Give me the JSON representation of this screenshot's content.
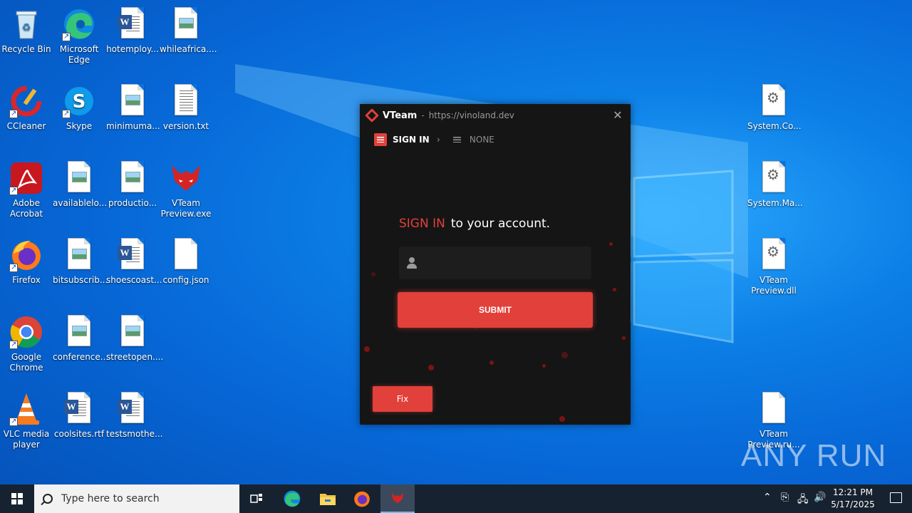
{
  "desktop": {
    "icons": [
      {
        "label": "Recycle Bin"
      },
      {
        "label": "Microsoft Edge"
      },
      {
        "label": "hotemploy..."
      },
      {
        "label": "whileafrica...."
      },
      {
        "label": "CCleaner"
      },
      {
        "label": "Skype"
      },
      {
        "label": "minimuma..."
      },
      {
        "label": "version.txt"
      },
      {
        "label": "Adobe Acrobat"
      },
      {
        "label": "availablelo..."
      },
      {
        "label": "productio..."
      },
      {
        "label": "VTeam Preview.exe"
      },
      {
        "label": "Firefox"
      },
      {
        "label": "bitsubscrib..."
      },
      {
        "label": "shoescoast..."
      },
      {
        "label": "config.json"
      },
      {
        "label": "Google Chrome"
      },
      {
        "label": "conference..."
      },
      {
        "label": "streetopen...."
      },
      {
        "label": "VLC media player"
      },
      {
        "label": "coolsites.rtf"
      },
      {
        "label": "testsmothe..."
      },
      {
        "label": "System.Co..."
      },
      {
        "label": "System.Ma..."
      },
      {
        "label": "VTeam Preview.dll"
      },
      {
        "label": "VTeam Preview.ru..."
      }
    ]
  },
  "app": {
    "name": "VTeam",
    "separator": "-",
    "url": "https://vinoland.dev",
    "close_glyph": "✕",
    "nav": {
      "signin": "SIGN IN",
      "chevron": "›",
      "none": "NONE"
    },
    "headline_accent": "SIGN IN",
    "headline_rest": "to your account.",
    "username_value": "",
    "submit_label": "SUBMIT",
    "fix_label": "Fix",
    "accent_color": "#e2403a"
  },
  "taskbar": {
    "search_placeholder": "Type here to search",
    "time": "12:21 PM",
    "date": "5/17/2025"
  },
  "watermark": "ANY RUN"
}
